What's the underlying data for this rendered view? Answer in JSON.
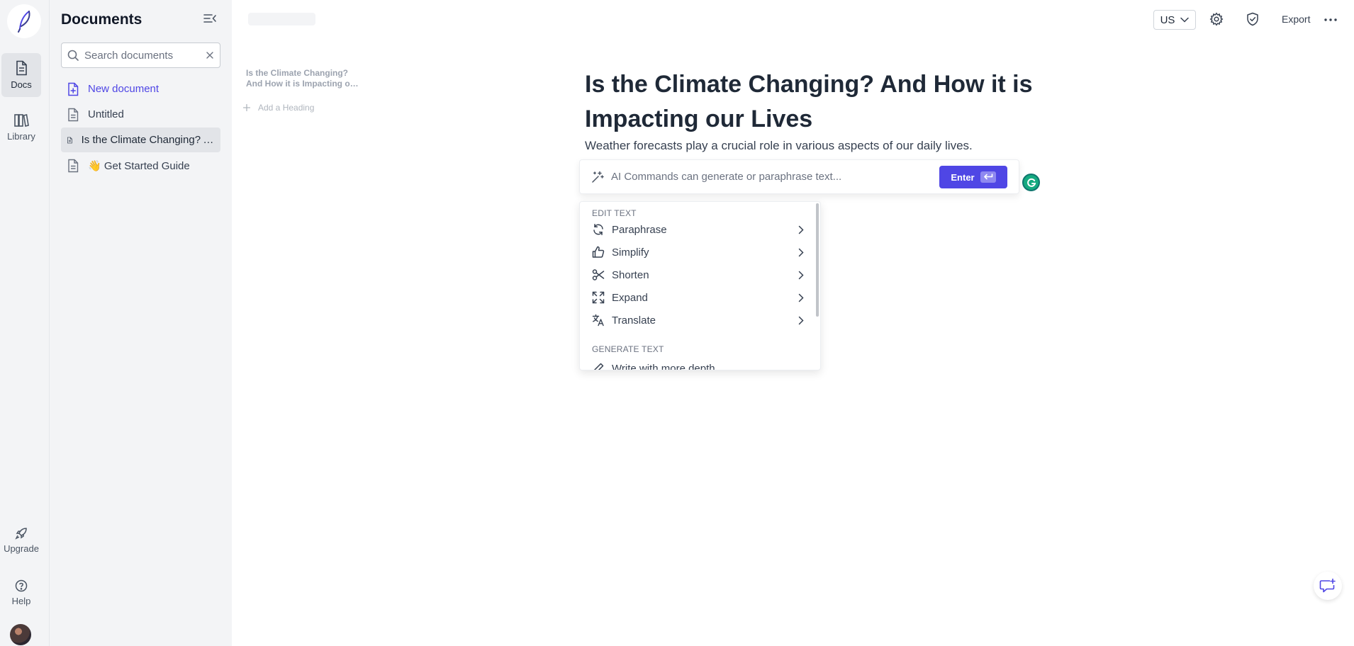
{
  "rail": {
    "items": [
      {
        "label": "Docs"
      },
      {
        "label": "Library"
      },
      {
        "label": "Upgrade"
      },
      {
        "label": "Help"
      }
    ]
  },
  "docs_panel": {
    "title": "Documents",
    "search": {
      "placeholder": "Search documents",
      "value": ""
    },
    "items": [
      {
        "label": "New document"
      },
      {
        "label": "Untitled"
      },
      {
        "label": "Is the Climate Changing? And How it is Impacting our Lives"
      },
      {
        "label": "👋 Get Started Guide"
      }
    ]
  },
  "outline": {
    "heading_line1": "Is the Climate Changing?",
    "heading_line2": "And How it is Impacting our Lives",
    "add_heading": "Add a Heading"
  },
  "toolbar": {
    "language": "US",
    "export_label": "Export"
  },
  "editor": {
    "title": "Is the Climate Changing? And How it is Impacting our Lives",
    "body": "Weather forecasts play a crucial role in various aspects of our daily lives."
  },
  "ai_bar": {
    "placeholder": "AI Commands can generate or paraphrase text...",
    "enter_label": "Enter"
  },
  "ai_menu": {
    "edit_section": "EDIT TEXT",
    "edit_items": [
      {
        "label": "Paraphrase"
      },
      {
        "label": "Simplify"
      },
      {
        "label": "Shorten"
      },
      {
        "label": "Expand"
      },
      {
        "label": "Translate"
      }
    ],
    "generate_section": "GENERATE TEXT",
    "generate_items": [
      {
        "label": "Write with more depth"
      }
    ]
  },
  "colors": {
    "accent": "#4f46e5",
    "panel_bg": "#f3f4f6",
    "grammarly": "#15aa80"
  }
}
